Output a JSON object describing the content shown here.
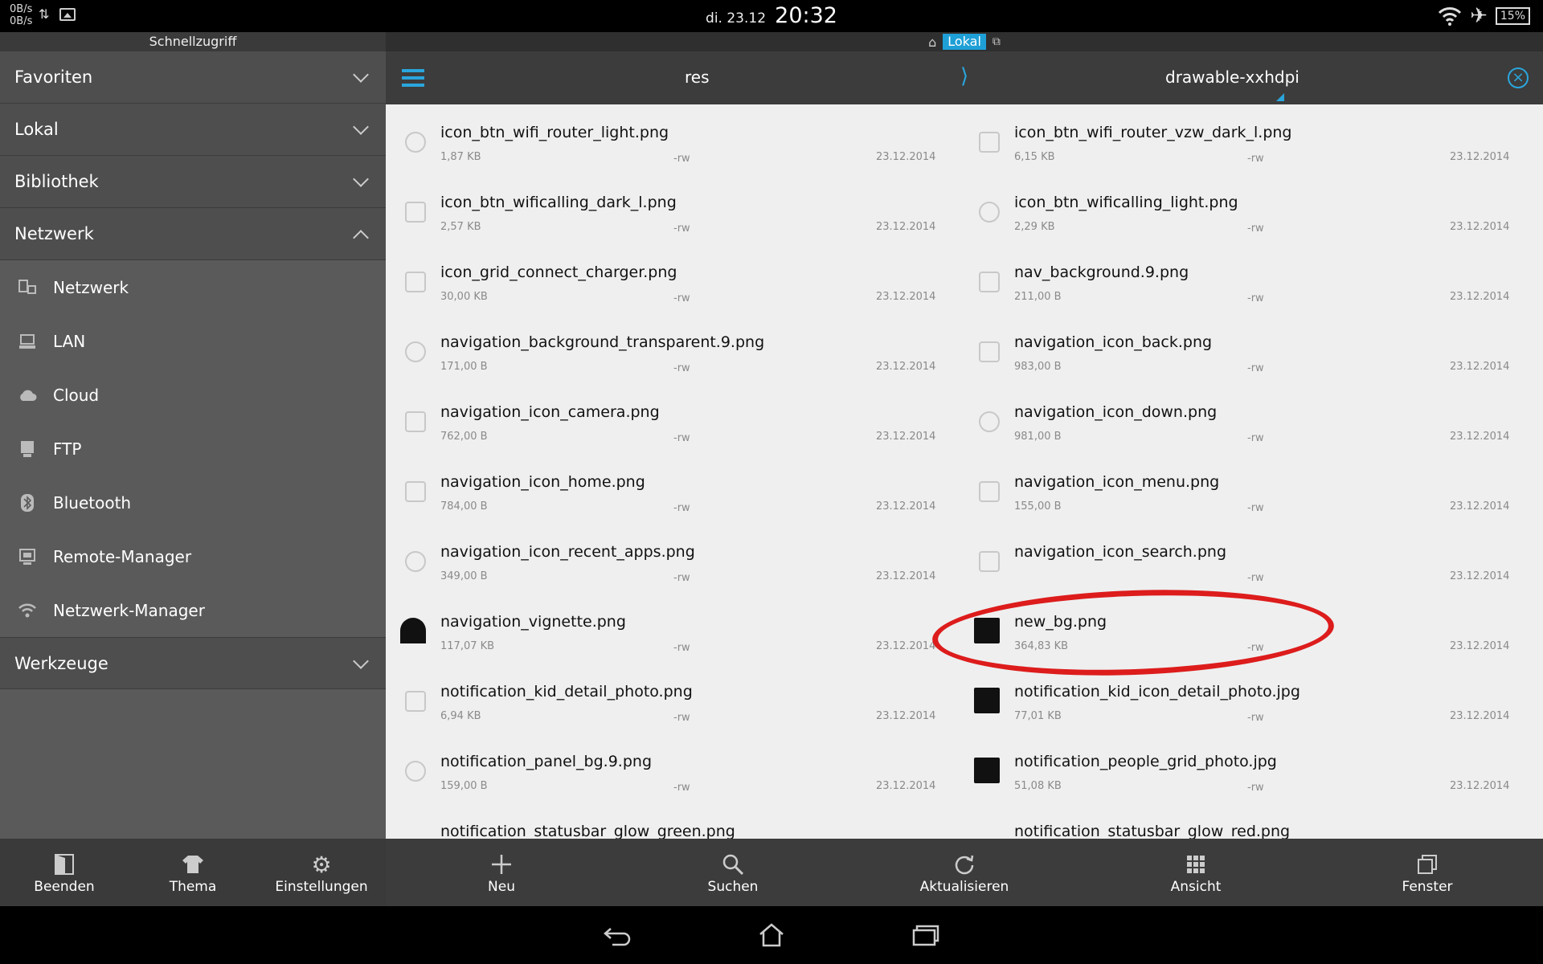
{
  "status": {
    "net_up": "0B/s",
    "net_down": "0B/s",
    "date": "di. 23.12",
    "time": "20:32",
    "battery": "15%"
  },
  "sidebar": {
    "title": "Schnellzugriff",
    "sections": [
      {
        "label": "Favoriten"
      },
      {
        "label": "Lokal"
      },
      {
        "label": "Bibliothek"
      },
      {
        "label": "Netzwerk"
      }
    ],
    "network_items": [
      {
        "label": "Netzwerk",
        "icon": "network-icon"
      },
      {
        "label": "LAN",
        "icon": "lan-icon"
      },
      {
        "label": "Cloud",
        "icon": "cloud-icon"
      },
      {
        "label": "FTP",
        "icon": "ftp-icon"
      },
      {
        "label": "Bluetooth",
        "icon": "bluetooth-icon"
      },
      {
        "label": "Remote-Manager",
        "icon": "remote-manager-icon"
      },
      {
        "label": "Netzwerk-Manager",
        "icon": "wifi-icon"
      }
    ],
    "tools_label": "Werkzeuge"
  },
  "toolbar_left": [
    {
      "label": "Beenden",
      "icon": "exit-icon"
    },
    {
      "label": "Thema",
      "icon": "theme-icon"
    },
    {
      "label": "Einstellungen",
      "icon": "gear-icon"
    }
  ],
  "toolbar_right": [
    {
      "label": "Neu",
      "icon": "plus-icon"
    },
    {
      "label": "Suchen",
      "icon": "search-icon"
    },
    {
      "label": "Aktualisieren",
      "icon": "refresh-icon"
    },
    {
      "label": "Ansicht",
      "icon": "grid-icon"
    },
    {
      "label": "Fenster",
      "icon": "windows-icon"
    }
  ],
  "tabline": {
    "active": "Lokal"
  },
  "header": {
    "parent": "res",
    "current": "drawable-xxhdpi"
  },
  "files": [
    {
      "name": "icon_btn_wifi_router_light.png",
      "size": "1,87 KB",
      "perm": "-rw",
      "date": "23.12.2014"
    },
    {
      "name": "icon_btn_wifi_router_vzw_dark_l.png",
      "size": "6,15 KB",
      "perm": "-rw",
      "date": "23.12.2014"
    },
    {
      "name": "icon_btn_wificalling_dark_l.png",
      "size": "2,57 KB",
      "perm": "-rw",
      "date": "23.12.2014"
    },
    {
      "name": "icon_btn_wificalling_light.png",
      "size": "2,29 KB",
      "perm": "-rw",
      "date": "23.12.2014"
    },
    {
      "name": "icon_grid_connect_charger.png",
      "size": "30,00 KB",
      "perm": "-rw",
      "date": "23.12.2014"
    },
    {
      "name": "nav_background.9.png",
      "size": "211,00 B",
      "perm": "-rw",
      "date": "23.12.2014"
    },
    {
      "name": "navigation_background_transparent.9.png",
      "size": "171,00 B",
      "perm": "-rw",
      "date": "23.12.2014"
    },
    {
      "name": "navigation_icon_back.png",
      "size": "983,00 B",
      "perm": "-rw",
      "date": "23.12.2014"
    },
    {
      "name": "navigation_icon_camera.png",
      "size": "762,00 B",
      "perm": "-rw",
      "date": "23.12.2014"
    },
    {
      "name": "navigation_icon_down.png",
      "size": "981,00 B",
      "perm": "-rw",
      "date": "23.12.2014"
    },
    {
      "name": "navigation_icon_home.png",
      "size": "784,00 B",
      "perm": "-rw",
      "date": "23.12.2014"
    },
    {
      "name": "navigation_icon_menu.png",
      "size": "155,00 B",
      "perm": "-rw",
      "date": "23.12.2014"
    },
    {
      "name": "navigation_icon_recent_apps.png",
      "size": "349,00 B",
      "perm": "-rw",
      "date": "23.12.2014"
    },
    {
      "name": "navigation_icon_search.png",
      "size": "",
      "perm": "-rw",
      "date": "23.12.2014"
    },
    {
      "name": "navigation_vignette.png",
      "size": "117,07 KB",
      "perm": "-rw",
      "date": "23.12.2014"
    },
    {
      "name": "new_bg.png",
      "size": "364,83 KB",
      "perm": "-rw",
      "date": "23.12.2014"
    },
    {
      "name": "notification_kid_detail_photo.png",
      "size": "6,94 KB",
      "perm": "-rw",
      "date": "23.12.2014"
    },
    {
      "name": "notification_kid_icon_detail_photo.jpg",
      "size": "77,01 KB",
      "perm": "-rw",
      "date": "23.12.2014"
    },
    {
      "name": "notification_panel_bg.9.png",
      "size": "159,00 B",
      "perm": "-rw",
      "date": "23.12.2014"
    },
    {
      "name": "notification_people_grid_photo.jpg",
      "size": "51,08 KB",
      "perm": "-rw",
      "date": "23.12.2014"
    },
    {
      "name": "notification_statusbar_glow_green.png",
      "size": "",
      "perm": "",
      "date": ""
    },
    {
      "name": "notification_statusbar_glow_red.png",
      "size": "",
      "perm": "",
      "date": ""
    }
  ],
  "colors": {
    "accent": "#2aa6dd",
    "highlight": "#dd1c1c"
  }
}
